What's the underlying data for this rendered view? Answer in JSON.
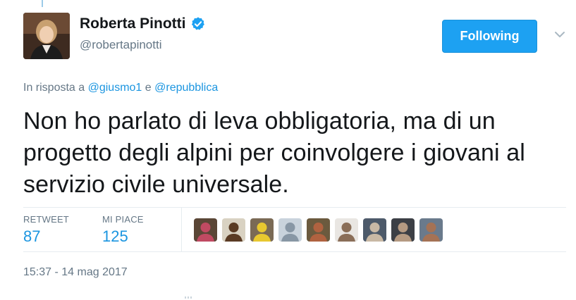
{
  "user": {
    "fullname": "Roberta Pinotti",
    "handle": "@robertapinotti",
    "verified": true,
    "avatar_icon": "profile-photo"
  },
  "follow_button": {
    "label": "Following"
  },
  "menu": {
    "icon": "chevron-down-icon"
  },
  "reply": {
    "prefix": "In risposta a",
    "mention1": "@giusmo1",
    "connector": "e",
    "mention2": "@repubblica"
  },
  "tweet": {
    "text": "Non ho parlato di leva obbligatoria, ma di un progetto degli alpini per coinvolgere i giovani al servizio civile universale."
  },
  "stats": {
    "retweets_label": "RETWEET",
    "retweets_value": "87",
    "likes_label": "MI PIACE",
    "likes_value": "125"
  },
  "liker_avatars": [
    {
      "name": "liker-avatar-1",
      "bg": "#5a4636",
      "fg": "#c04a62"
    },
    {
      "name": "liker-avatar-2",
      "bg": "#d9d2c2",
      "fg": "#5a3b24"
    },
    {
      "name": "liker-avatar-3",
      "bg": "#7a6a55",
      "fg": "#e8c830"
    },
    {
      "name": "liker-avatar-4",
      "bg": "#c9d3dc",
      "fg": "#8897a5"
    },
    {
      "name": "liker-avatar-5",
      "bg": "#6b5a3e",
      "fg": "#b06240"
    },
    {
      "name": "liker-avatar-6",
      "bg": "#e9e6e2",
      "fg": "#8a6e58"
    },
    {
      "name": "liker-avatar-7",
      "bg": "#4d5a6a",
      "fg": "#c9b9a5"
    },
    {
      "name": "liker-avatar-8",
      "bg": "#3c3f45",
      "fg": "#b59a82"
    },
    {
      "name": "liker-avatar-9",
      "bg": "#6a7a8c",
      "fg": "#a57255"
    }
  ],
  "timestamp": "15:37 - 14 mag 2017",
  "colors": {
    "accent": "#1da1f2",
    "link": "#1b95e0",
    "muted": "#657786",
    "text": "#14171a"
  }
}
